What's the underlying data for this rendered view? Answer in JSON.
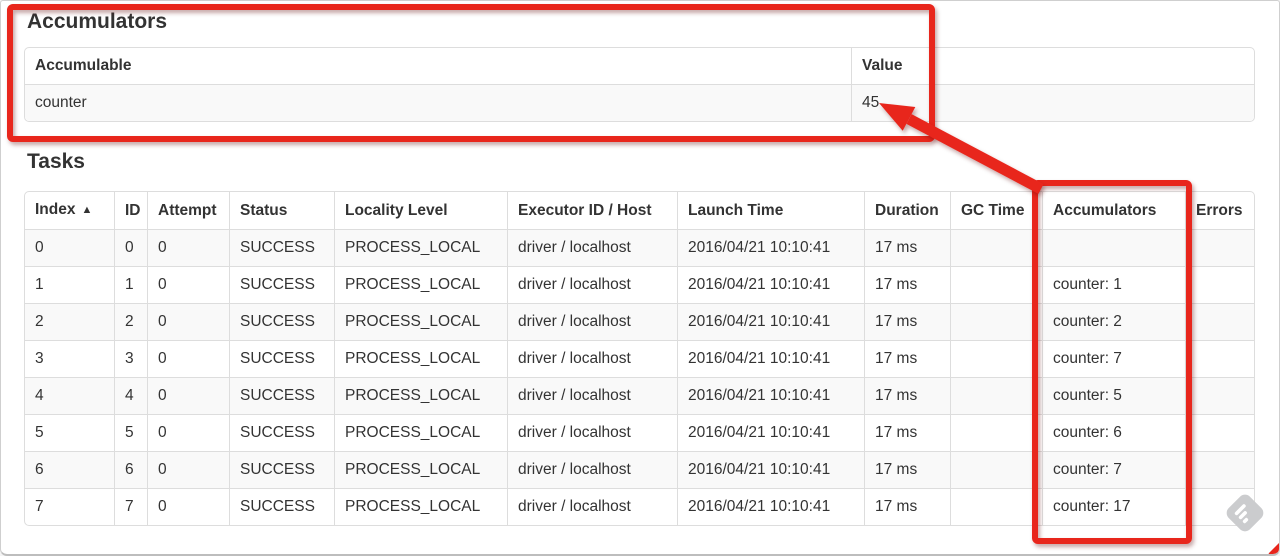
{
  "accumulators_section": {
    "heading": "Accumulators",
    "columns": [
      "Accumulable",
      "Value"
    ],
    "rows": [
      {
        "accumulable": "counter",
        "value": "45"
      }
    ]
  },
  "tasks_section": {
    "heading": "Tasks",
    "sort_icon": "▲",
    "columns": [
      "Index",
      "ID",
      "Attempt",
      "Status",
      "Locality Level",
      "Executor ID / Host",
      "Launch Time",
      "Duration",
      "GC Time",
      "Accumulators",
      "Errors"
    ],
    "rows": [
      {
        "index": "0",
        "id": "0",
        "attempt": "0",
        "status": "SUCCESS",
        "locality_level": "PROCESS_LOCAL",
        "executor_id_host": "driver / localhost",
        "launch_time": "2016/04/21 10:10:41",
        "duration": "17 ms",
        "gc_time": "",
        "accumulators": "",
        "errors": ""
      },
      {
        "index": "1",
        "id": "1",
        "attempt": "0",
        "status": "SUCCESS",
        "locality_level": "PROCESS_LOCAL",
        "executor_id_host": "driver / localhost",
        "launch_time": "2016/04/21 10:10:41",
        "duration": "17 ms",
        "gc_time": "",
        "accumulators": "counter: 1",
        "errors": ""
      },
      {
        "index": "2",
        "id": "2",
        "attempt": "0",
        "status": "SUCCESS",
        "locality_level": "PROCESS_LOCAL",
        "executor_id_host": "driver / localhost",
        "launch_time": "2016/04/21 10:10:41",
        "duration": "17 ms",
        "gc_time": "",
        "accumulators": "counter: 2",
        "errors": ""
      },
      {
        "index": "3",
        "id": "3",
        "attempt": "0",
        "status": "SUCCESS",
        "locality_level": "PROCESS_LOCAL",
        "executor_id_host": "driver / localhost",
        "launch_time": "2016/04/21 10:10:41",
        "duration": "17 ms",
        "gc_time": "",
        "accumulators": "counter: 7",
        "errors": ""
      },
      {
        "index": "4",
        "id": "4",
        "attempt": "0",
        "status": "SUCCESS",
        "locality_level": "PROCESS_LOCAL",
        "executor_id_host": "driver / localhost",
        "launch_time": "2016/04/21 10:10:41",
        "duration": "17 ms",
        "gc_time": "",
        "accumulators": "counter: 5",
        "errors": ""
      },
      {
        "index": "5",
        "id": "5",
        "attempt": "0",
        "status": "SUCCESS",
        "locality_level": "PROCESS_LOCAL",
        "executor_id_host": "driver / localhost",
        "launch_time": "2016/04/21 10:10:41",
        "duration": "17 ms",
        "gc_time": "",
        "accumulators": "counter: 6",
        "errors": ""
      },
      {
        "index": "6",
        "id": "6",
        "attempt": "0",
        "status": "SUCCESS",
        "locality_level": "PROCESS_LOCAL",
        "executor_id_host": "driver / localhost",
        "launch_time": "2016/04/21 10:10:41",
        "duration": "17 ms",
        "gc_time": "",
        "accumulators": "counter: 7",
        "errors": ""
      },
      {
        "index": "7",
        "id": "7",
        "attempt": "0",
        "status": "SUCCESS",
        "locality_level": "PROCESS_LOCAL",
        "executor_id_host": "driver / localhost",
        "launch_time": "2016/04/21 10:10:41",
        "duration": "17 ms",
        "gc_time": "",
        "accumulators": "counter: 17",
        "errors": ""
      }
    ]
  },
  "annotations": {
    "red": "#e8251c"
  },
  "watermark": {
    "color": "#cbccce"
  }
}
